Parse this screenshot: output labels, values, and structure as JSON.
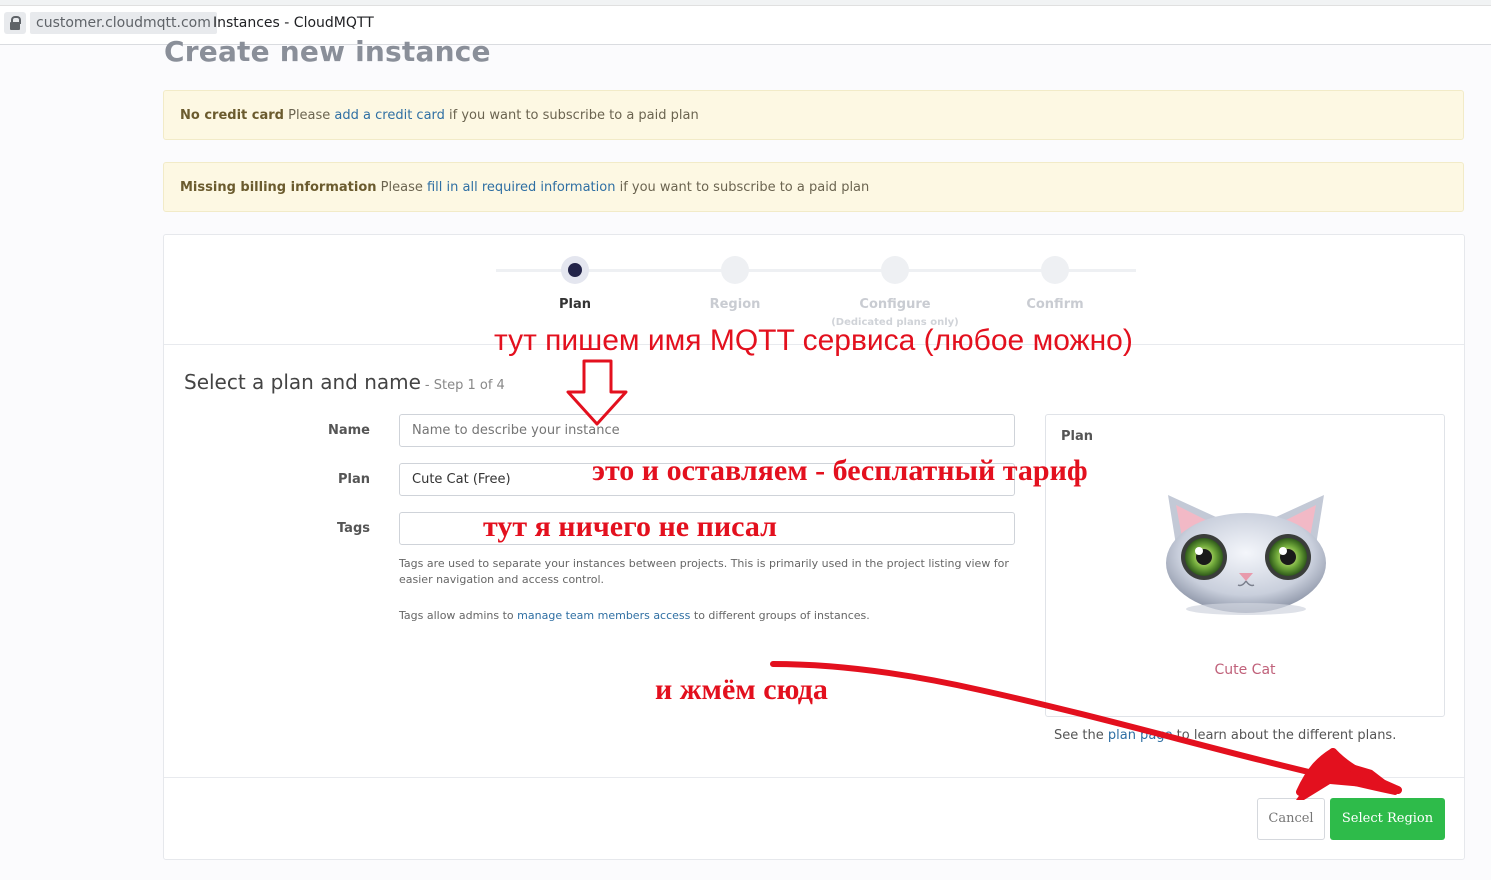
{
  "browser": {
    "domain": "customer.cloudmqtt.com",
    "tab_title": "Instances - CloudMQTT"
  },
  "page": {
    "title": "Create new instance"
  },
  "alerts": [
    {
      "bold": "No credit card",
      "pre": " Please ",
      "link": "add a credit card",
      "post": " if you want to subscribe to a paid plan"
    },
    {
      "bold": "Missing billing information",
      "pre": " Please ",
      "link": "fill in all required information",
      "post": " if you want to subscribe to a paid plan"
    }
  ],
  "stepper": {
    "steps": [
      {
        "label": "Plan",
        "sub": "",
        "active": true
      },
      {
        "label": "Region",
        "sub": "",
        "active": false
      },
      {
        "label": "Configure",
        "sub": "(Dedicated plans only)",
        "active": false
      },
      {
        "label": "Confirm",
        "sub": "",
        "active": false
      }
    ]
  },
  "section": {
    "title": "Select a plan and name",
    "subtitle": "- Step 1 of 4"
  },
  "form": {
    "name_label": "Name",
    "name_placeholder": "Name to describe your instance",
    "name_value": "",
    "plan_label": "Plan",
    "plan_value": "Cute Cat (Free)",
    "tags_label": "Tags",
    "tags_value": "",
    "tags_help_1": "Tags are used to separate your instances between projects. This is primarily used in the project listing view for easier navigation and access control.",
    "tags_help_2_pre": "Tags allow admins to ",
    "tags_help_2_link": "manage team members access",
    "tags_help_2_post": " to different groups of instances."
  },
  "plan_panel": {
    "title": "Plan",
    "plan_name": "Cute Cat",
    "image_icon": "cute-cat-mascot",
    "see_pre": "See the ",
    "see_link": "plan page",
    "see_post": " to learn about the different plans."
  },
  "buttons": {
    "cancel": "Cancel",
    "submit": "Select Region"
  },
  "annotations": {
    "name_hint": "тут пишем имя MQTT сервиса (любое можно)",
    "plan_hint": "это и оставляем - бесплатный тариф",
    "tags_hint": "тут я ничего не писал",
    "click_hint": "и жмём сюда",
    "color": "#e3101e"
  },
  "colors": {
    "accent_green": "#2ebb4a",
    "link": "#2f6fa3",
    "alert_bg": "#fdf8e3",
    "active_step": "#232449",
    "plan_name": "#c0617a"
  }
}
